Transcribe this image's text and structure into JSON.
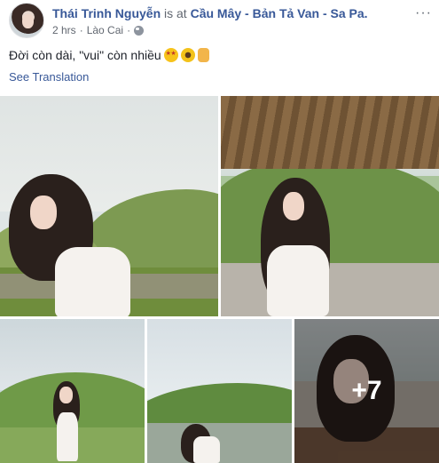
{
  "post": {
    "author": "Thái Trinh Nguyễn",
    "is_at": "is at",
    "place": "Cầu Mây - Bản Tả Van - Sa Pa.",
    "time": "2 hrs",
    "separator": "·",
    "location": "Lào Cai",
    "separator2": "·",
    "privacy_icon": "globe-icon",
    "menu_label": "···",
    "text": "Đời còn dài, \"vui\" còn nhiều",
    "emojis": [
      "star-struck",
      "sunflower",
      "love-you-gesture"
    ],
    "see_translation": "See Translation"
  },
  "gallery": {
    "photo_count_total": 12,
    "visible_photos": 5,
    "more_overlay": "+7"
  },
  "colors": {
    "link_blue": "#385898",
    "meta_gray": "#616770",
    "text_dark": "#1d2129"
  }
}
